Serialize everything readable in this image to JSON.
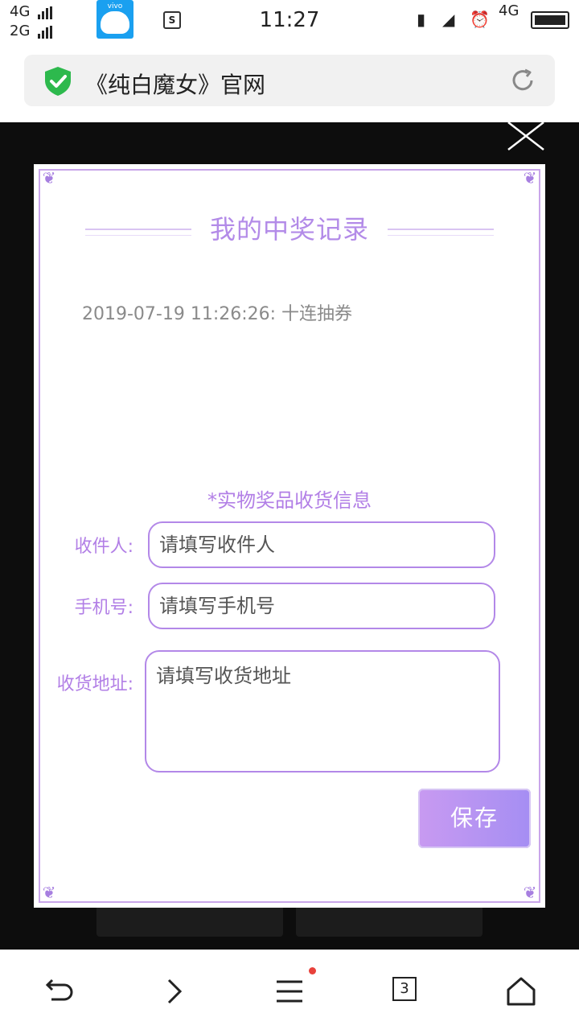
{
  "status_bar": {
    "network_top": "4G",
    "network_bottom": "2G",
    "vivo_label": "vivo",
    "time": "11:27",
    "network_right": "4G",
    "s_icon": "S"
  },
  "address_bar": {
    "title": "《纯白魔女》官网",
    "secure_icon": "shield-check-icon",
    "reload_icon": "reload-icon"
  },
  "modal": {
    "title": "我的中奖记录",
    "records": [
      "2019-07-19 11:26:26: 十连抽券"
    ],
    "section_label": "*实物奖品收货信息",
    "fields": {
      "recipient": {
        "label": "收件人:",
        "placeholder": "请填写收件人"
      },
      "phone": {
        "label": "手机号:",
        "placeholder": "请填写手机号"
      },
      "address": {
        "label": "收货地址:",
        "placeholder": "请填写收货地址"
      }
    },
    "save_label": "保存"
  },
  "bottom_nav": {
    "tab_count": "3",
    "icons": [
      "back-icon",
      "forward-icon",
      "menu-icon",
      "tabs-icon",
      "home-icon"
    ]
  },
  "colors": {
    "accent": "#b27fe6",
    "button_gradient_start": "#c89af1",
    "button_gradient_end": "#a58ef3",
    "secure": "#2db94d"
  }
}
